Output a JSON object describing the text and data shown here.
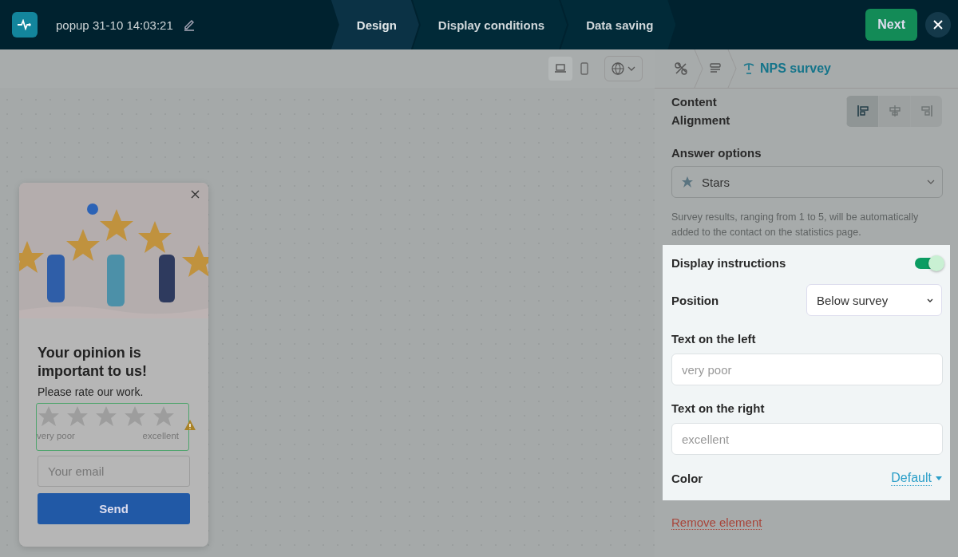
{
  "header": {
    "title": "popup 31-10 14:03:21",
    "steps": [
      {
        "label": "Design",
        "selected": true
      },
      {
        "label": "Display conditions",
        "selected": false
      },
      {
        "label": "Data saving",
        "selected": false
      }
    ],
    "next_button": "Next"
  },
  "toolbar": {
    "devices": [
      {
        "kind": "desktop",
        "selected": true
      },
      {
        "kind": "mobile",
        "selected": false
      }
    ]
  },
  "popup": {
    "title": "Your opinion is important to us!",
    "subtitle": "Please rate our work.",
    "rating": {
      "stars": 0,
      "label_left": "very poor",
      "label_right": "excellent"
    },
    "email": {
      "placeholder": "Your email"
    },
    "send_button": "Send"
  },
  "panel": {
    "breadcrumb": [
      {
        "kind": "settings"
      },
      {
        "kind": "form"
      },
      {
        "kind": "survey",
        "label": "NPS survey"
      }
    ],
    "alignment": {
      "label": "Content Alignment",
      "options": [
        {
          "kind": "left",
          "selected": true
        },
        {
          "kind": "center",
          "selected": false
        },
        {
          "kind": "right",
          "selected": false
        }
      ]
    },
    "answer_options": {
      "label": "Answer options",
      "value": "Stars"
    },
    "note": "Survey results, ranging from 1 to 5, will be automatically added to the contact on the statistics page.",
    "instructions": {
      "label": "Display instructions",
      "on": true,
      "position_label": "Position",
      "position_value": "Below survey",
      "left_label": "Text on the left",
      "left_placeholder": "very poor",
      "right_label": "Text on the right",
      "right_placeholder": "excellent",
      "color_label": "Color",
      "color_value": "Default"
    },
    "remove_link": "Remove element"
  }
}
